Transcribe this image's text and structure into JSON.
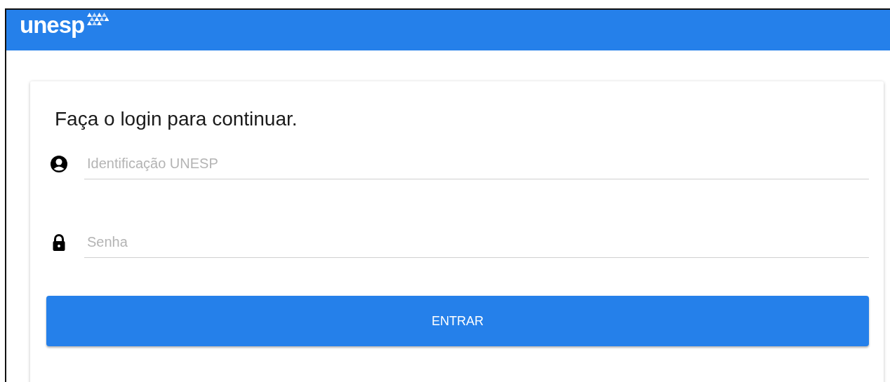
{
  "header": {
    "logo": "unesp"
  },
  "login": {
    "title": "Faça o login para continuar.",
    "fields": [
      {
        "kind": "user",
        "placeholder": "Identificação UNESP"
      },
      {
        "kind": "password",
        "placeholder": "Senha"
      }
    ],
    "button": "ENTRAR"
  }
}
